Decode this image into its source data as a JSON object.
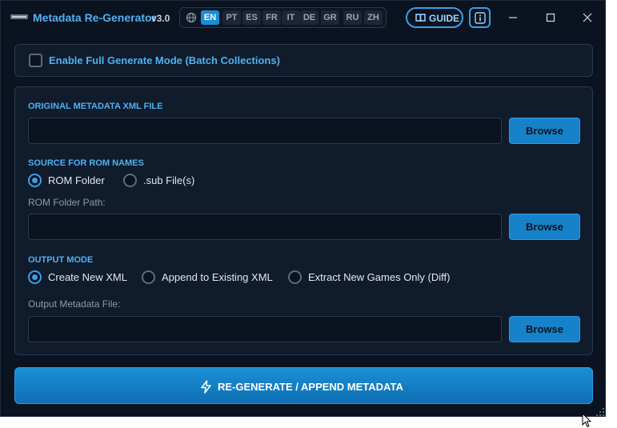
{
  "window": {
    "title": "Metadata Re-Generator",
    "version": "v3.0"
  },
  "languages": [
    "EN",
    "PT",
    "ES",
    "FR",
    "IT",
    "DE",
    "GR",
    "RU",
    "ZH"
  ],
  "active_language": "EN",
  "header": {
    "guide_label": "GUIDE",
    "info_label": "i"
  },
  "batch": {
    "label": "Enable Full Generate Mode (Batch Collections)",
    "checked": false
  },
  "original_xml": {
    "section_label": "ORIGINAL METADATA XML FILE",
    "value": "",
    "browse_label": "Browse"
  },
  "rom_source": {
    "section_label": "SOURCE FOR ROM NAMES",
    "options": [
      {
        "label": "ROM Folder",
        "selected": true
      },
      {
        "label": ".sub File(s)",
        "selected": false
      }
    ],
    "field_label": "ROM Folder Path:",
    "value": "",
    "browse_label": "Browse"
  },
  "output_mode": {
    "section_label": "OUTPUT MODE",
    "options": [
      {
        "label": "Create New XML",
        "selected": true
      },
      {
        "label": "Append to Existing XML",
        "selected": false
      },
      {
        "label": "Extract New Games Only (Diff)",
        "selected": false
      }
    ],
    "field_label": "Output Metadata File:",
    "value": "",
    "browse_label": "Browse"
  },
  "action": {
    "label": "RE-GENERATE / APPEND METADATA"
  },
  "colors": {
    "background": "#0b1220",
    "panel": "#101b2c",
    "accent": "#4fb1f0",
    "button": "#1582c9"
  }
}
